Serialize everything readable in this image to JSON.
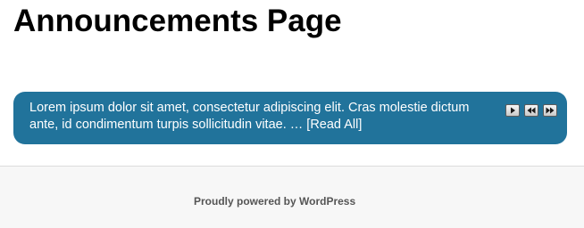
{
  "page": {
    "title": "Announcements Page"
  },
  "ticker": {
    "text": "Lorem ipsum dolor sit amet, consectetur adipiscing elit. Cras molestie dictum ante, id condimentum turpis sollicitudin vitae. … ",
    "read_all_label": "[Read All]",
    "background_color": "#21739b",
    "controls": [
      {
        "name": "play",
        "icon": "play-icon"
      },
      {
        "name": "previous",
        "icon": "rewind-icon"
      },
      {
        "name": "next",
        "icon": "fast-forward-icon"
      }
    ]
  },
  "footer": {
    "credit": "Proudly powered by WordPress"
  }
}
